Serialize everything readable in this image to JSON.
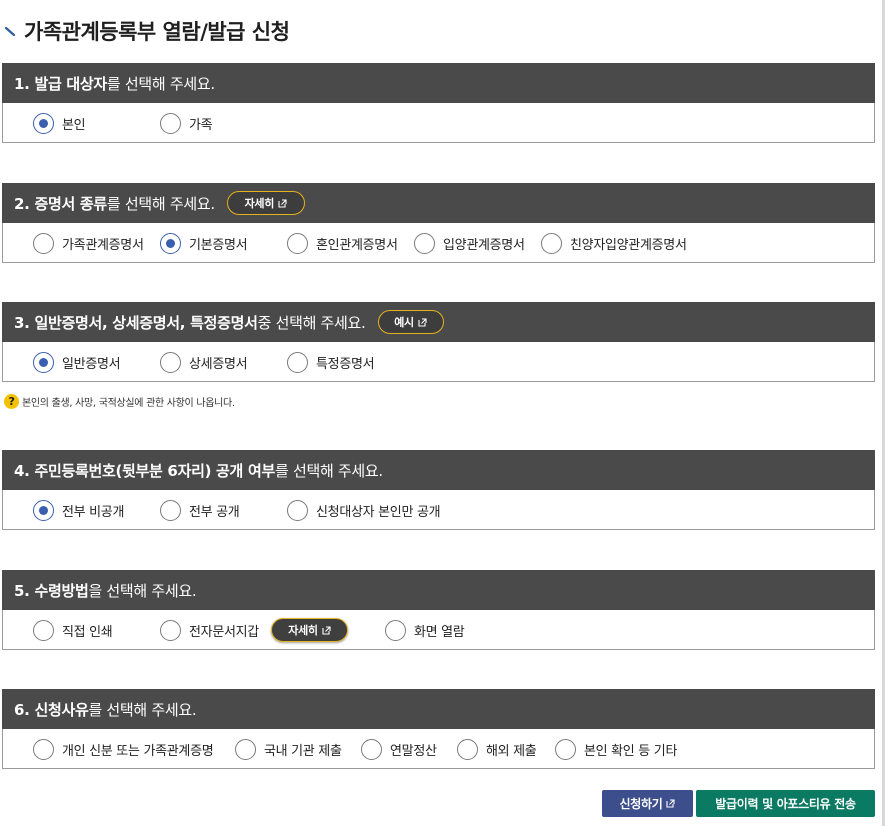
{
  "page": {
    "title": "가족관계등록부 열람/발급 신청"
  },
  "sections": [
    {
      "head_bold": "1. 발급 대상자",
      "head_rest": "를 선택해 주세요.",
      "options": [
        {
          "label": "본인",
          "selected": true
        },
        {
          "label": "가족",
          "selected": false
        }
      ]
    },
    {
      "head_bold": "2. 증명서 종류",
      "head_rest": "를 선택해 주세요.",
      "pill": "자세히",
      "options": [
        {
          "label": "가족관계증명서",
          "selected": false
        },
        {
          "label": "기본증명서",
          "selected": true
        },
        {
          "label": "혼인관계증명서",
          "selected": false
        },
        {
          "label": "입양관계증명서",
          "selected": false
        },
        {
          "label": "친양자입양관계증명서",
          "selected": false
        }
      ]
    },
    {
      "head_bold": "3. 일반증명서, 상세증명서, 특정증명서",
      "head_rest": " 중 선택해 주세요.",
      "pill": "예시",
      "options": [
        {
          "label": "일반증명서",
          "selected": true
        },
        {
          "label": "상세증명서",
          "selected": false
        },
        {
          "label": "특정증명서",
          "selected": false
        }
      ],
      "note": "본인의 출생, 사망, 국적상실에 관한 사항이 나옵니다."
    },
    {
      "head_bold": "4. 주민등록번호(뒷부분 6자리) 공개 여부",
      "head_rest": "를 선택해 주세요.",
      "options": [
        {
          "label": "전부 비공개",
          "selected": true
        },
        {
          "label": "전부 공개",
          "selected": false
        },
        {
          "label": "신청대상자 본인만 공개",
          "selected": false
        }
      ]
    },
    {
      "head_bold": "5. 수령방법",
      "head_rest": "을 선택해 주세요.",
      "inline_pill": "자세히",
      "options": [
        {
          "label": "직접 인쇄",
          "selected": false
        },
        {
          "label": "전자문서지갑",
          "selected": false
        },
        {
          "label": "화면 열람",
          "selected": false
        }
      ]
    },
    {
      "head_bold": "6. 신청사유",
      "head_rest": "를 선택해 주세요.",
      "options": [
        {
          "label": "개인 신분 또는 가족관계증명",
          "selected": false
        },
        {
          "label": "국내 기관 제출",
          "selected": false
        },
        {
          "label": "연말정산",
          "selected": false
        },
        {
          "label": "해외 제출",
          "selected": false
        },
        {
          "label": "본인 확인 등 기타",
          "selected": false
        }
      ]
    }
  ],
  "buttons": {
    "apply": "신청하기",
    "send": "발급이력 및 아포스티유 전송"
  },
  "colors": {
    "header_bg": "#4a4a4a",
    "radio_selected": "#3b5fb0",
    "pill_border": "#e6b21e",
    "apply_button": "#3d4e8c",
    "send_button": "#0b7a63"
  },
  "icons": {
    "title_marker": "diagonal-mark-icon",
    "external_link": "external-link-icon",
    "help": "question-icon"
  }
}
